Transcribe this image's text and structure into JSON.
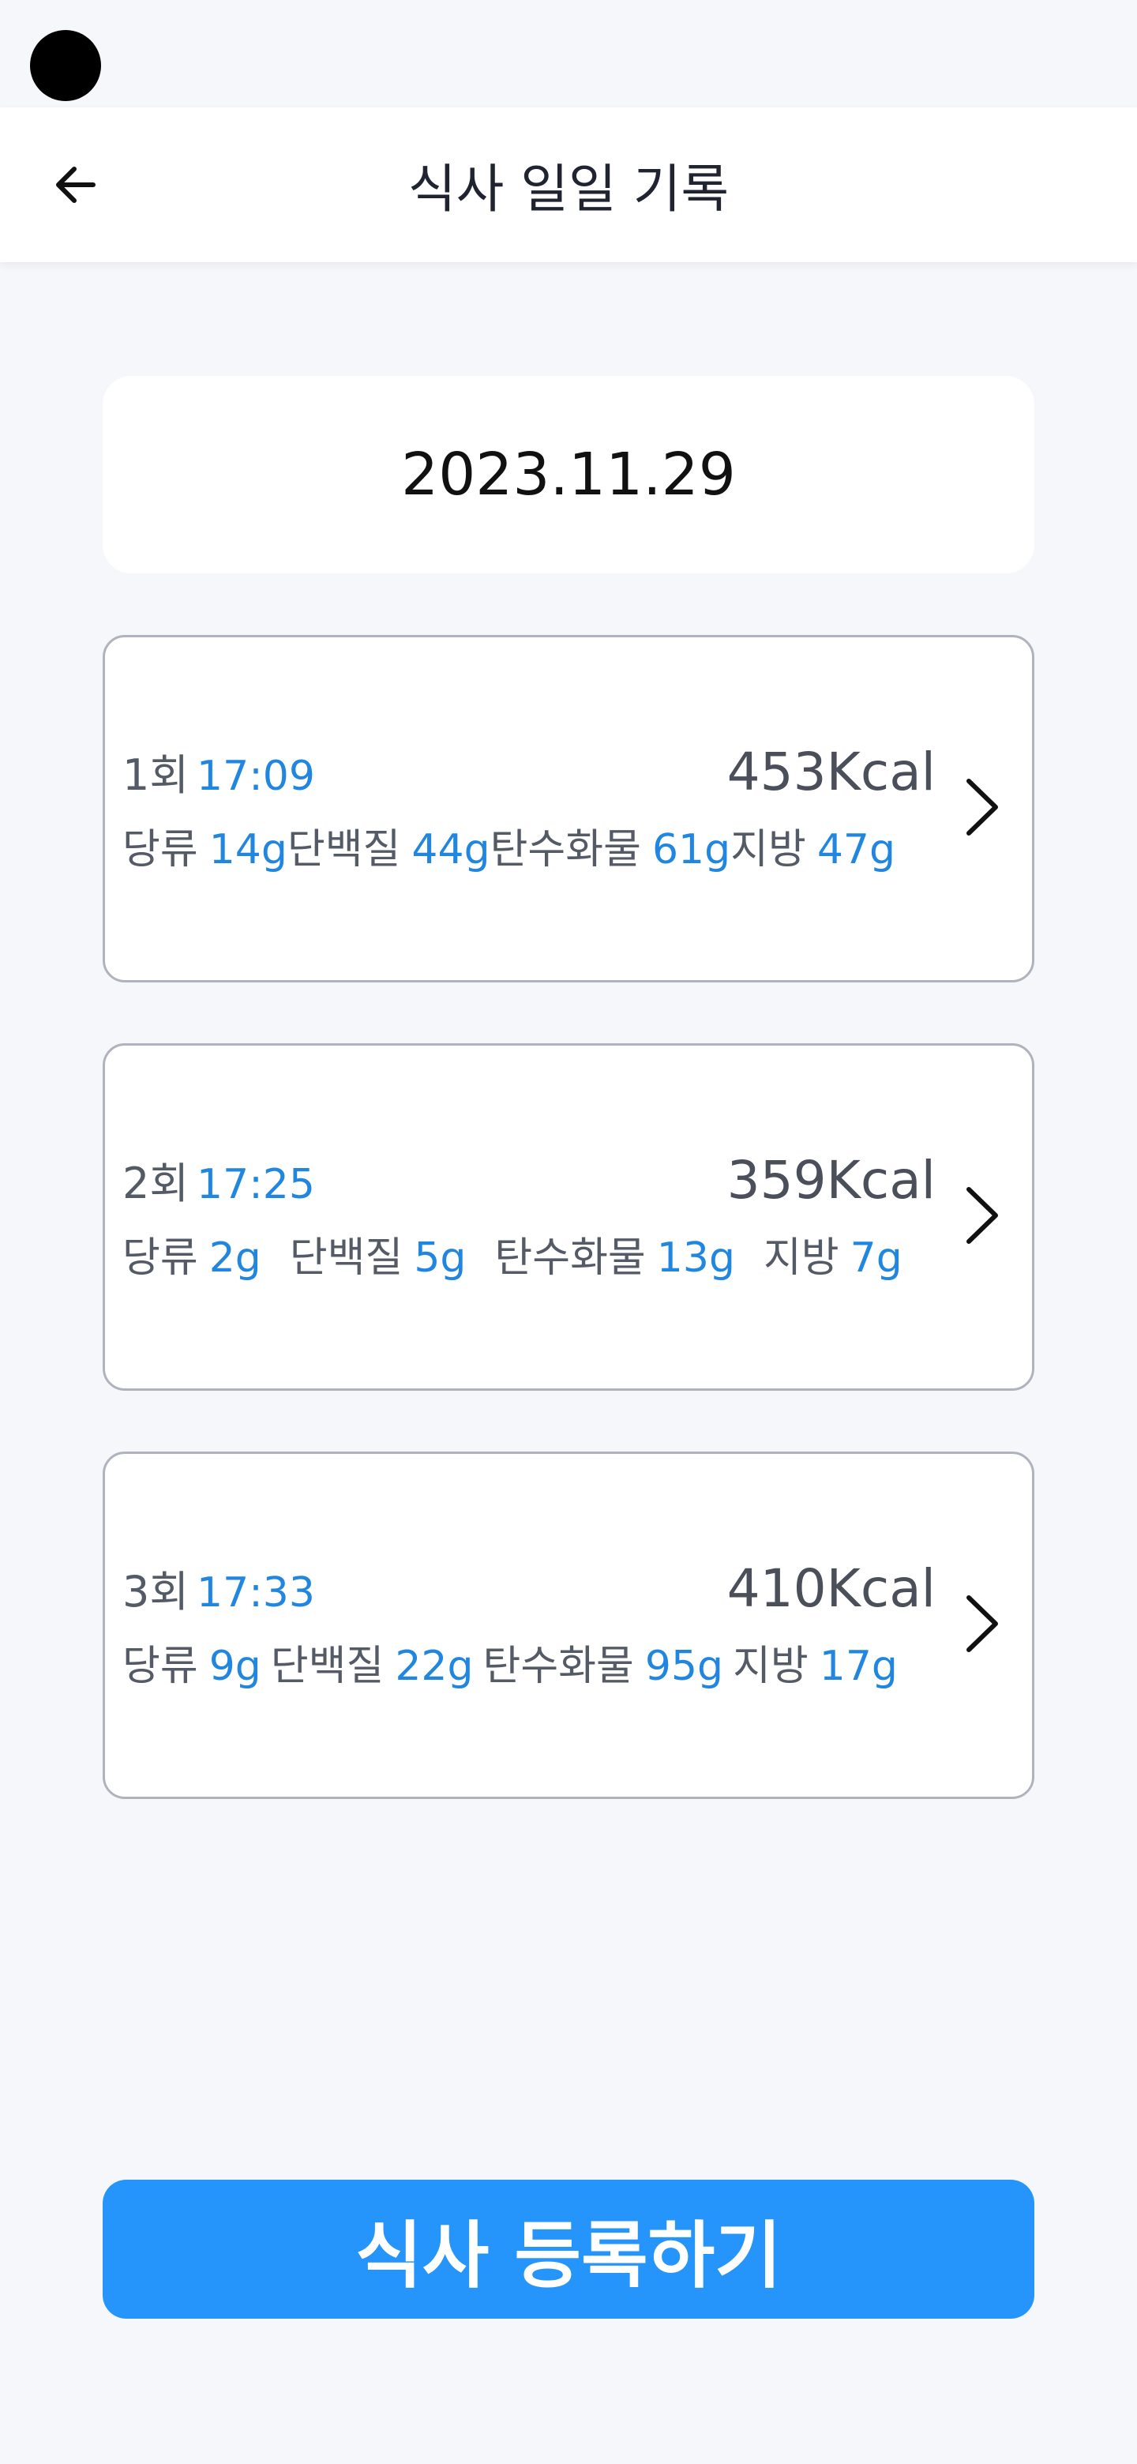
{
  "header": {
    "title": "식사 일일 기록",
    "back_icon": "arrow-left-icon"
  },
  "date": "2023.11.29",
  "meals": [
    {
      "index_label": "1회",
      "time": "17:09",
      "kcal": "453Kcal",
      "nutrients": [
        {
          "label": "당류",
          "value": "14g"
        },
        {
          "label": "단백질",
          "value": "44g"
        },
        {
          "label": "탄수화물",
          "value": "61g"
        },
        {
          "label": "지방",
          "value": "47g"
        }
      ]
    },
    {
      "index_label": "2회",
      "time": "17:25",
      "kcal": "359Kcal",
      "nutrients": [
        {
          "label": "당류",
          "value": "2g"
        },
        {
          "label": "단백질",
          "value": "5g"
        },
        {
          "label": "탄수화물",
          "value": "13g"
        },
        {
          "label": "지방",
          "value": "7g"
        }
      ]
    },
    {
      "index_label": "3회",
      "time": "17:33",
      "kcal": "410Kcal",
      "nutrients": [
        {
          "label": "당류",
          "value": "9g"
        },
        {
          "label": "단백질",
          "value": "22g"
        },
        {
          "label": "탄수화물",
          "value": "95g"
        },
        {
          "label": "지방",
          "value": "17g"
        }
      ]
    }
  ],
  "register_button_label": "식사 등록하기",
  "colors": {
    "accent": "#2594fb",
    "value_text": "#2186e0",
    "card_border": "#aeb3be",
    "background": "#f6f7fb"
  }
}
